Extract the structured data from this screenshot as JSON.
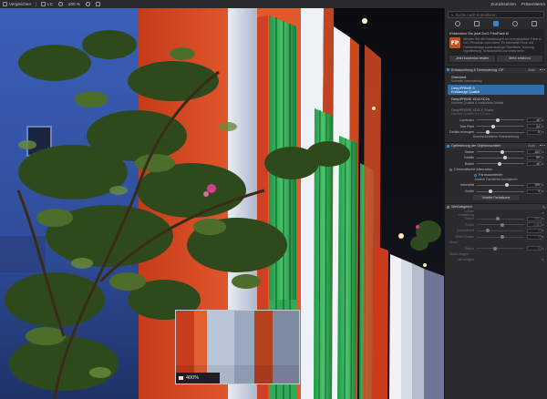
{
  "toolbar": {
    "compare_label": "Vergleichen",
    "compare_mode": "LC",
    "zoom_label": "200 %",
    "export_label": "Zurücksetzen",
    "present_label": "Präsentieren"
  },
  "canvas": {
    "loupe_zoom": "400%"
  },
  "panel": {
    "search_placeholder": "Suche nach Korrekturen",
    "tool_icons": [
      "exposure-icon",
      "retouch-icon",
      "color-icon",
      "detail-icon",
      "pipette-icon"
    ],
    "promo": {
      "title": "Entdecken Sie jetzt DxO FilmPack 6!",
      "logo": "FP",
      "text": "Wecken Sie die Erinnerungen an unvergessliche Filme in DxO PhotoLab zum Leben. Es beinhaltet Filme und Farbrenderings sowie analoge Filmeffekte, Körnung, Vignettierung, Schwarzweiß und vieles mehr.",
      "btn_try": "Jetzt kostenlos testen",
      "btn_more": "Mehr erfahren"
    },
    "denoise": {
      "title": "Entrauschung & Demosaicing: DP",
      "auto": "Auto",
      "options": [
        {
          "title": "Standard",
          "sub": "Schnelle Demosaicing"
        },
        {
          "title": "DeepPRIME 3",
          "sub": "Erstklassige Qualität"
        },
        {
          "title": "DeepPRIME XD2/XD2s",
          "sub": "Höchste Qualität & zusätzliche Details"
        },
        {
          "title": "DeepPRIME XD3 X-Trans",
          "sub": "Höchste Qualität für X-Trans"
        }
      ],
      "sliders": [
        {
          "label": "Luminanz",
          "value": "40",
          "pos": 0.4
        },
        {
          "label": "Tote Pixel",
          "value": "24",
          "pos": 0.3
        },
        {
          "label": "Details erzeugen",
          "value": "5",
          "pos": 0.2
        }
      ],
      "link": "Durchschnittliche Entrauschung"
    },
    "lens": {
      "title": "Optimierung der Objektivschärfe",
      "auto": "Auto",
      "sliders": [
        {
          "label": "Stärke",
          "value": "100",
          "pos": 0.5
        },
        {
          "label": "Details",
          "value": "50",
          "pos": 0.55
        },
        {
          "label": "Bokeh",
          "value": "40",
          "pos": 0.45
        }
      ],
      "aberration_label": "Chromatische Aberration",
      "color_fringe_label": "Farbsaumfehler",
      "fringe_section": "Andere Farbfehler korrigieren",
      "fringe_sliders": [
        {
          "label": "Intensität",
          "value": "100",
          "pos": 0.6
        },
        {
          "label": "Größe",
          "value": "4",
          "pos": 0.25
        }
      ],
      "purple_btn": "Violette Farbsäume"
    },
    "hsl": {
      "title": "Weißabgleich",
      "rows": [
        {
          "label": "Lokale Einstellung",
          "value": "",
          "pos": 0
        },
        {
          "label": "Stärke",
          "value": "100",
          "pos": 0.4
        },
        {
          "label": "Größe",
          "value": "0.50",
          "pos": 0.5
        },
        {
          "label": "Schwellwert",
          "value": "4",
          "pos": 0.2
        },
        {
          "label": "Mittel-Zusatz",
          "value": "0",
          "pos": 0.5
        }
      ],
      "moire": "Moiré",
      "moire_rows": [
        {
          "label": "Stärke",
          "value": "0",
          "pos": 0.35
        }
      ],
      "sensor": "Staub-Augen",
      "sensor_rows": [
        {
          "label": "Hinzufügen",
          "value": "",
          "pos": 0
        }
      ]
    }
  }
}
